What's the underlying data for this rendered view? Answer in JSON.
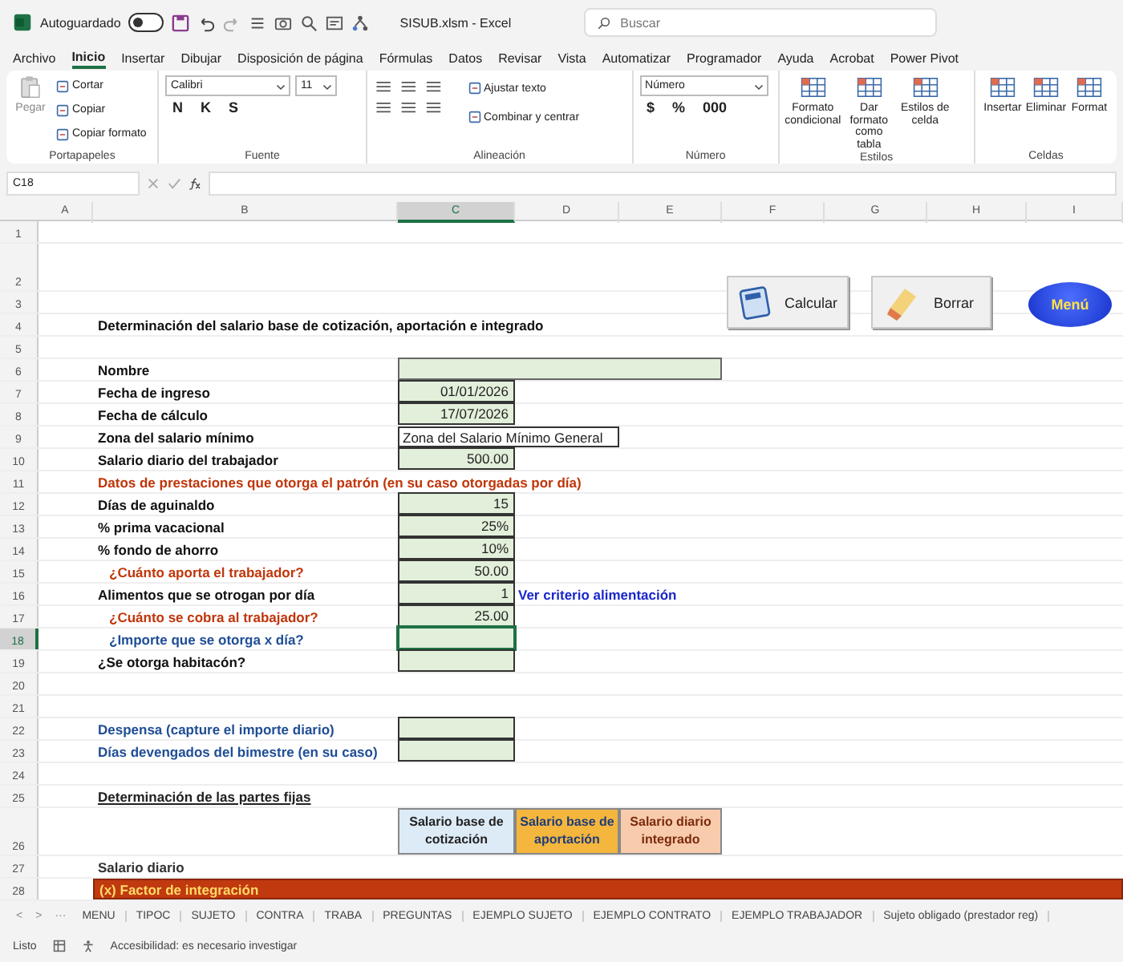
{
  "title_bar": {
    "autosave_label": "Autoguardado",
    "autosave_on": false,
    "file_title": "SISUB.xlsm  -  Excel",
    "search": {
      "placeholder": "Buscar"
    }
  },
  "menu_tabs": [
    {
      "label": "Archivo",
      "selected": false
    },
    {
      "label": "Inicio",
      "selected": true
    },
    {
      "label": "Insertar",
      "selected": false
    },
    {
      "label": "Dibujar",
      "selected": false
    },
    {
      "label": "Disposición de página",
      "selected": false
    },
    {
      "label": "Fórmulas",
      "selected": false
    },
    {
      "label": "Datos",
      "selected": false
    },
    {
      "label": "Revisar",
      "selected": false
    },
    {
      "label": "Vista",
      "selected": false
    },
    {
      "label": "Automatizar",
      "selected": false
    },
    {
      "label": "Programador",
      "selected": false
    },
    {
      "label": "Ayuda",
      "selected": false
    },
    {
      "label": "Acrobat",
      "selected": false
    },
    {
      "label": "Power Pivot",
      "selected": false
    }
  ],
  "ribbon": {
    "groups": [
      {
        "label": "Portapapeles",
        "items": [
          {
            "kind": "paste",
            "label": "Pegar"
          },
          {
            "kind": "small",
            "label": "Cortar"
          },
          {
            "kind": "small",
            "label": "Copiar"
          },
          {
            "kind": "small",
            "label": "Copiar formato"
          }
        ]
      },
      {
        "label": "Fuente",
        "items": [
          {
            "kind": "dropdown",
            "label": "Calibri"
          },
          {
            "kind": "dropdown",
            "label": "11"
          },
          {
            "kind": "glyph",
            "label": "N"
          },
          {
            "kind": "glyph",
            "label": "K"
          },
          {
            "kind": "glyph",
            "label": "S"
          }
        ]
      },
      {
        "label": "Alineación",
        "items": [
          {
            "kind": "align"
          },
          {
            "kind": "small",
            "label": "Ajustar texto"
          },
          {
            "kind": "small",
            "label": "Combinar y centrar"
          }
        ]
      },
      {
        "label": "Número",
        "items": [
          {
            "kind": "dropdown",
            "label": "Número"
          },
          {
            "kind": "glyph",
            "label": "$"
          },
          {
            "kind": "glyph",
            "label": "%"
          },
          {
            "kind": "glyph",
            "label": "000"
          }
        ]
      },
      {
        "label": "Estilos",
        "items": [
          {
            "kind": "big",
            "label": "Formato condicional"
          },
          {
            "kind": "big",
            "label": "Dar formato como tabla"
          },
          {
            "kind": "big",
            "label": "Estilos de celda"
          }
        ]
      },
      {
        "label": "Celdas",
        "items": [
          {
            "kind": "big",
            "label": "Insertar"
          },
          {
            "kind": "big",
            "label": "Eliminar"
          },
          {
            "kind": "big",
            "label": "Format"
          }
        ]
      }
    ]
  },
  "formula_bar": {
    "name_box": "C18"
  },
  "columns": [
    {
      "label": "A",
      "selected": false
    },
    {
      "label": "B",
      "selected": false
    },
    {
      "label": "C",
      "selected": true
    },
    {
      "label": "D",
      "selected": false
    },
    {
      "label": "E",
      "selected": false
    },
    {
      "label": "F",
      "selected": false
    },
    {
      "label": "G",
      "selected": false
    },
    {
      "label": "H",
      "selected": false
    },
    {
      "label": "I",
      "selected": false
    }
  ],
  "sheet_buttons": [
    {
      "kind": "calculator",
      "label": "Calcular"
    },
    {
      "kind": "eraser",
      "label": "Borrar"
    },
    {
      "kind": "oval",
      "label": "Menú"
    }
  ],
  "rows": [
    {
      "number": "1",
      "selected": false
    },
    {
      "number": "2",
      "selected": false,
      "tall": true
    },
    {
      "number": "3",
      "selected": false
    },
    {
      "number": "4",
      "selected": false,
      "b": {
        "kind": "label",
        "text": "Determinación del salario base de cotización, aportación e integrado"
      }
    },
    {
      "number": "5",
      "selected": false
    },
    {
      "number": "6",
      "selected": false,
      "b": {
        "kind": "label",
        "text": "Nombre"
      },
      "c": {
        "kind": "input-wide"
      }
    },
    {
      "number": "7",
      "selected": false,
      "b": {
        "kind": "label",
        "text": "Fecha de ingreso"
      },
      "c": {
        "kind": "input",
        "text": "01/01/2026"
      }
    },
    {
      "number": "8",
      "selected": false,
      "b": {
        "kind": "label",
        "text": "Fecha de cálculo"
      },
      "c": {
        "kind": "input",
        "text": "17/07/2026"
      }
    },
    {
      "number": "9",
      "selected": false,
      "b": {
        "kind": "label",
        "text": "Zona del salario mínimo"
      },
      "c": {
        "kind": "boxed",
        "text": "Zona del Salario Mínimo General"
      }
    },
    {
      "number": "10",
      "selected": false,
      "b": {
        "kind": "label",
        "text": "Salario diario del trabajador"
      },
      "c": {
        "kind": "input",
        "text": "500.00"
      }
    },
    {
      "number": "11",
      "selected": false,
      "b": {
        "kind": "label-red",
        "text": "Datos de prestaciones que otorga el patrón (en su caso otorgadas por día)"
      }
    },
    {
      "number": "12",
      "selected": false,
      "b": {
        "kind": "label",
        "text": "Días de aguinaldo"
      },
      "c": {
        "kind": "input",
        "text": "15"
      }
    },
    {
      "number": "13",
      "selected": false,
      "b": {
        "kind": "label",
        "text": "% prima vacacional"
      },
      "c": {
        "kind": "input",
        "text": "25%"
      }
    },
    {
      "number": "14",
      "selected": false,
      "b": {
        "kind": "label",
        "text": "% fondo de ahorro"
      },
      "c": {
        "kind": "input",
        "text": "10%"
      }
    },
    {
      "number": "15",
      "selected": false,
      "b": {
        "kind": "sub-red",
        "text": "¿Cuánto aporta el trabajador?"
      },
      "c": {
        "kind": "input",
        "text": "50.00"
      }
    },
    {
      "number": "16",
      "selected": false,
      "b": {
        "kind": "label",
        "text": "Alimentos que se otrogan por día"
      },
      "c": {
        "kind": "input",
        "text": "1"
      },
      "d": {
        "kind": "link",
        "text": "Ver criterio alimentación"
      }
    },
    {
      "number": "17",
      "selected": false,
      "b": {
        "kind": "sub-red",
        "text": "¿Cuánto se cobra al trabajador?"
      },
      "c": {
        "kind": "input",
        "text": "25.00"
      }
    },
    {
      "number": "18",
      "selected": true,
      "b": {
        "kind": "sub-blue",
        "text": "¿Importe que se otorga x día?"
      },
      "c": {
        "kind": "input"
      }
    },
    {
      "number": "19",
      "selected": false,
      "b": {
        "kind": "label",
        "text": "¿Se otorga habitacón?"
      },
      "c": {
        "kind": "input"
      }
    },
    {
      "number": "20",
      "selected": false
    },
    {
      "number": "21",
      "selected": false
    },
    {
      "number": "22",
      "selected": false,
      "b": {
        "kind": "label-blue",
        "text": "Despensa (capture el importe diario)"
      },
      "c": {
        "kind": "input"
      }
    },
    {
      "number": "23",
      "selected": false,
      "b": {
        "kind": "label-blue",
        "text": "Días devengados del bimestre (en su caso)"
      },
      "c": {
        "kind": "input"
      }
    },
    {
      "number": "24",
      "selected": false
    },
    {
      "number": "25",
      "selected": false,
      "b": {
        "kind": "underlined",
        "text": "Determinación de las partes fijas"
      }
    },
    {
      "number": "26",
      "selected": false,
      "tall": true,
      "c": {
        "kind": "header-blue",
        "text": "Salario base de cotización"
      },
      "d": {
        "kind": "header-orange",
        "text": "Salario base de aportación"
      },
      "e": {
        "kind": "header-peach",
        "text": "Salario diario integrado"
      }
    },
    {
      "number": "27",
      "selected": false,
      "b": {
        "kind": "label-olive",
        "text": "Salario diario"
      }
    },
    {
      "number": "28",
      "selected": false,
      "b": {
        "kind": "banner",
        "text": "(x) Factor de integración"
      }
    }
  ],
  "sheet_tabs": {
    "nav": [
      "<",
      ">",
      "···"
    ],
    "tabs": [
      "MENU",
      "TIPOC",
      "SUJETO",
      "CONTRA",
      "TRABA",
      "PREGUNTAS",
      "EJEMPLO SUJETO",
      "EJEMPLO CONTRATO",
      "EJEMPLO TRABAJADOR",
      "Sujeto obligado (prestador reg)"
    ]
  },
  "status_bar": {
    "status": "Listo",
    "accessibility": "Accesibilidad: es necesario investigar"
  }
}
